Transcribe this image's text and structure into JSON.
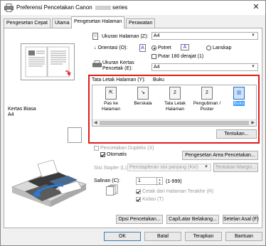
{
  "window": {
    "title": "Preferensi Pencetakan Canon ",
    "title_suffix": "series",
    "close_glyph": "✕"
  },
  "tabs": [
    {
      "label": "Pengesetan Cepat"
    },
    {
      "label": "Utama"
    },
    {
      "label": "Pengesetan Halaman"
    },
    {
      "label": "Perawatan"
    }
  ],
  "left": {
    "media_label": "Kertas Biasa",
    "media_size": "A4"
  },
  "page_size": {
    "label": "Ukuran Halaman (Z):",
    "value": "A4"
  },
  "orientation": {
    "label": "Orientasi (O):",
    "portrait_icon": "A",
    "portrait": "Potret",
    "landscape_icon": "A",
    "landscape": "Lanskap",
    "rotate180": "Putar 180 derajat (1)"
  },
  "printer_paper": {
    "label_line1": "Ukuran Kertas",
    "label_line2": "Pencetak (E):",
    "value": "A4"
  },
  "layout": {
    "label": "Tata Letak Halaman (Y):",
    "value": "Buku",
    "items": [
      {
        "label": "Pas ke Halaman",
        "glyph": "⇱"
      },
      {
        "label": "Berskala",
        "glyph": "↘"
      },
      {
        "label": "Tata Letak Halaman",
        "glyph": "2"
      },
      {
        "label": "Pengubinan / Poster",
        "glyph": "2"
      },
      {
        "label": "Buku",
        "glyph": "▥"
      }
    ],
    "scroll_left": "◀",
    "scroll_right": "▶",
    "tentukan": "Tentukan..."
  },
  "duplex": {
    "label": "Pencetakan Dupleks (X)",
    "auto_label": "Otomatis",
    "area_button": "Pengesetan Area Pencetakan..."
  },
  "stapler": {
    "label": "Sisi Stapler (L):",
    "value": "Penstapleran sisi panjang (Kiri)",
    "margin_button": "Tentukan Margin..."
  },
  "copies": {
    "label": "Salinan (C):",
    "value": "1",
    "range": "(1-999)",
    "print_last_first": "Cetak dari Halaman Terakhir (R)",
    "collate": "Kolasi (T)"
  },
  "bottom_buttons": {
    "options": "Opsi Pencetakan...",
    "stamp": "Cap/Latar Belakang...",
    "defaults": "Setelan Asal (F)"
  },
  "dialog_buttons": {
    "ok": "OK",
    "cancel": "Batal",
    "apply": "Terapkan",
    "help": "Bantuan"
  },
  "colors": {
    "highlight": "#e01b1b",
    "selection": "#3399ff"
  }
}
